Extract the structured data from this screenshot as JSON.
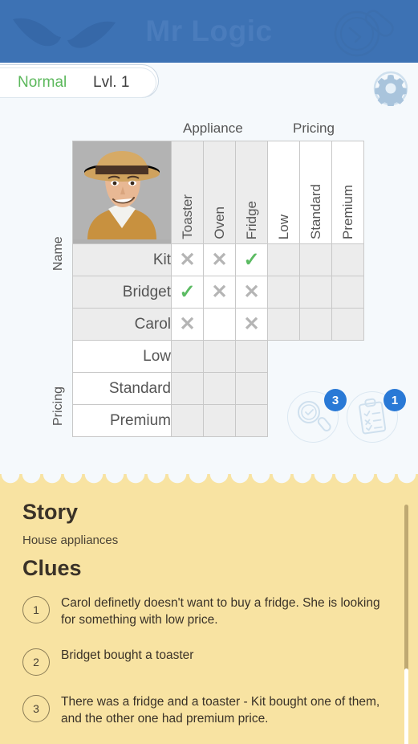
{
  "header": {
    "title": "Mr Logic",
    "moustache_icon": "moustache-logo",
    "magnifier_icon": "magnifier-logo"
  },
  "levelbar": {
    "difficulty": "Normal",
    "level": "Lvl. 1",
    "settings_icon": "gear-icon"
  },
  "grid": {
    "avatar_alt": "detective-avatar",
    "top_categories": [
      {
        "label": "Appliance"
      },
      {
        "label": "Pricing"
      }
    ],
    "side_categories": [
      {
        "label": "Name"
      },
      {
        "label": "Pricing"
      }
    ],
    "columns": [
      {
        "label": "Toaster",
        "group": "Appliance"
      },
      {
        "label": "Oven",
        "group": "Appliance"
      },
      {
        "label": "Fridge",
        "group": "Appliance"
      },
      {
        "label": "Low",
        "group": "Pricing"
      },
      {
        "label": "Standard",
        "group": "Pricing"
      },
      {
        "label": "Premium",
        "group": "Pricing"
      }
    ],
    "rows": [
      {
        "label": "Kit",
        "group": "Name",
        "cells": [
          "x",
          "x",
          "v",
          "",
          "",
          ""
        ]
      },
      {
        "label": "Bridget",
        "group": "Name",
        "cells": [
          "v",
          "x",
          "x",
          "",
          "",
          ""
        ]
      },
      {
        "label": "Carol",
        "group": "Name",
        "cells": [
          "x",
          "",
          "x",
          "",
          "",
          ""
        ]
      },
      {
        "label": "Low",
        "group": "Pricing",
        "cells": [
          "",
          "",
          ""
        ]
      },
      {
        "label": "Standard",
        "group": "Pricing",
        "cells": [
          "",
          "",
          ""
        ]
      },
      {
        "label": "Premium",
        "group": "Pricing",
        "cells": [
          "",
          "",
          ""
        ]
      }
    ],
    "mark_glyphs": {
      "x": "✕",
      "v": "✓"
    }
  },
  "actions": [
    {
      "name": "hint-button",
      "icon": "magnifier-check-icon",
      "badge": "3"
    },
    {
      "name": "notes-button",
      "icon": "clipboard-icon",
      "badge": "1"
    }
  ],
  "clues_panel": {
    "story_heading": "Story",
    "story_text": "House appliances",
    "clues_heading": "Clues",
    "clues": [
      {
        "num": "1",
        "text": "Carol definetly doesn't want to buy a fridge. She is looking for something with low price."
      },
      {
        "num": "2",
        "text": "Bridget bought a toaster"
      },
      {
        "num": "3",
        "text": "There was a fridge and a toaster - Kit bought one of them, and the other one had premium price."
      }
    ]
  },
  "colors": {
    "header_blue": "#3d72b4",
    "accent_blue": "#2979d6",
    "check_green": "#5cbb63",
    "cross_gray": "#b5b5b5",
    "panel_yellow": "#f8e3a2",
    "page_bg": "#f5f9fc"
  }
}
